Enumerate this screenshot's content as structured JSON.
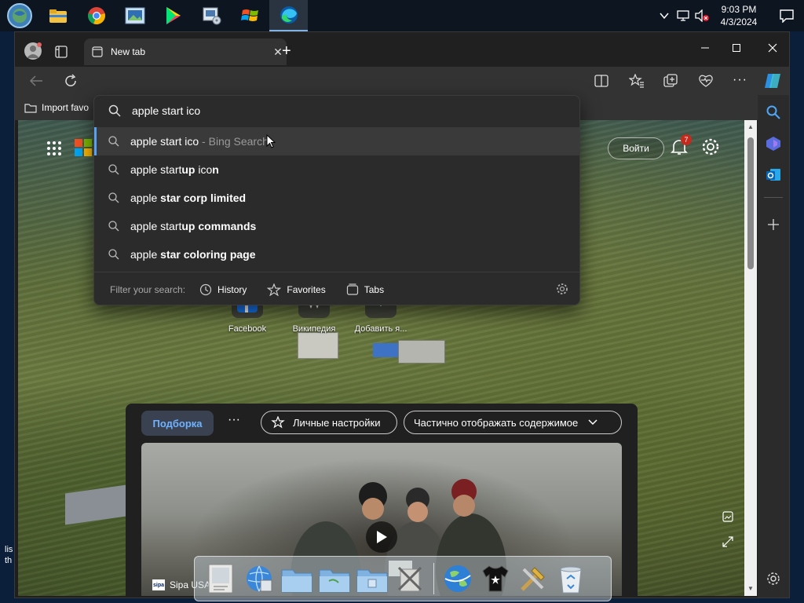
{
  "taskbar": {
    "clock_time": "9:03 PM",
    "clock_date": "4/3/2024",
    "apps": [
      "start-orb-icon",
      "file-explorer-icon",
      "chrome-icon",
      "photos-icon",
      "play-store-icon",
      "media-player-icon",
      "windows-flag-icon",
      "edge-icon"
    ]
  },
  "browser": {
    "tab_title": "New tab",
    "favbar_import": "Import favo"
  },
  "omnibox": {
    "input": "apple start ico",
    "suggestions": [
      {
        "plain": "apple start ico",
        "bold": "",
        "plain2": "",
        "source": " - Bing Search"
      },
      {
        "plain": "apple start",
        "bold": "up",
        "plain2": " ico",
        "bold2": "n",
        "source": ""
      },
      {
        "plain": "apple ",
        "bold": "star corp limited",
        "plain2": "",
        "source": ""
      },
      {
        "plain": "apple start",
        "bold": "up commands",
        "plain2": "",
        "source": ""
      },
      {
        "plain": "apple ",
        "bold": "star coloring page",
        "plain2": "",
        "source": ""
      }
    ],
    "filter_label": "Filter your search:",
    "filter_history": "History",
    "filter_favorites": "Favorites",
    "filter_tabs": "Tabs"
  },
  "ntp": {
    "signin_label": "Войти",
    "notification_count": "7",
    "tiles": [
      {
        "label": "Facebook"
      },
      {
        "label": "Википедия"
      },
      {
        "label": "Добавить я..."
      }
    ]
  },
  "feed": {
    "selected_tab": "Подборка",
    "more": "···",
    "personalize_label": "Личные настройки",
    "display_label": "Частично отображать содержимое",
    "source_label": "Sipa USA",
    "source_logo": "sipa"
  },
  "colors": {
    "accent": "#5aa0f0",
    "feed_selected": "#6fb2ff",
    "badge": "#c42b1c"
  }
}
